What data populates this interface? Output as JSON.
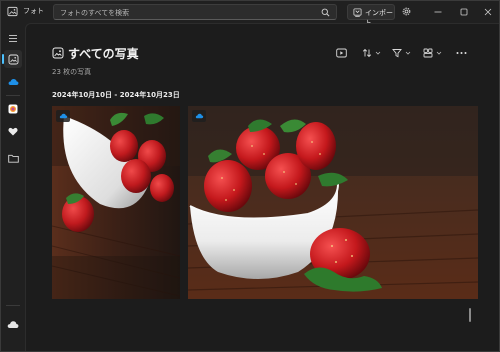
{
  "app": {
    "title": "フォト"
  },
  "search": {
    "placeholder": "フォトのすべてを検索"
  },
  "toolbar": {
    "import_label": "インポート"
  },
  "page": {
    "title": "すべての写真",
    "count": "23 枚の写真",
    "date_range": "2024年10月10日 - 2024年10月23日"
  },
  "nav": {
    "items": [
      {
        "icon": "hamburger-menu-icon"
      },
      {
        "icon": "gallery-icon",
        "active": true
      },
      {
        "icon": "onedrive-cloud-icon"
      },
      {
        "icon": "photos-app-icon"
      },
      {
        "icon": "heart-icon"
      },
      {
        "icon": "folder-icon"
      },
      {
        "icon": "cloud-icon"
      }
    ]
  },
  "actions": [
    {
      "icon": "slideshow-icon"
    },
    {
      "icon": "sort-icon"
    },
    {
      "icon": "filter-icon"
    },
    {
      "icon": "view-icon"
    },
    {
      "icon": "more-options-icon"
    }
  ],
  "photos": [
    {
      "icon": "onedrive-cloud-icon",
      "subject": "strawberries-in-white-bowl-tilted"
    },
    {
      "icon": "onedrive-cloud-icon",
      "subject": "strawberries-in-white-bowl"
    }
  ],
  "colors": {
    "accent": "#4cc2ff",
    "background": "#1c1c1c",
    "onedrive": "#1e90e8"
  }
}
